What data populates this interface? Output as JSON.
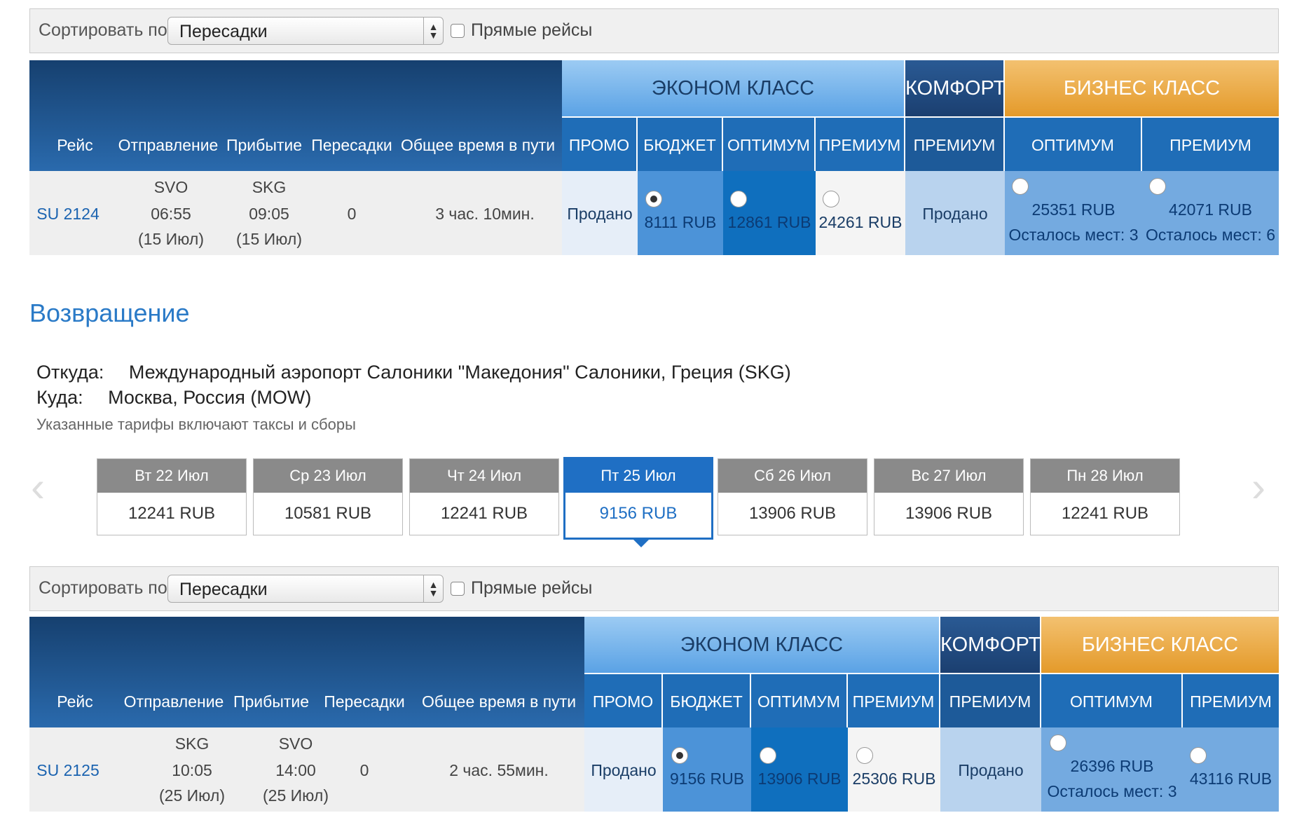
{
  "sort": {
    "label": "Сортировать по",
    "value": "Пересадки",
    "direct_label": "Прямые рейсы"
  },
  "columns": {
    "flight": "Рейс",
    "departure": "Отправление",
    "arrival": "Прибытие",
    "stops": "Пересадки",
    "duration": "Общее время в пути"
  },
  "classes": {
    "economy": "ЭКОНОМ КЛАСС",
    "comfort": "КОМФОРТ",
    "business": "БИЗНЕС КЛАСС"
  },
  "tariffs": {
    "promo": "ПРОМО",
    "budget": "БЮДЖЕТ",
    "optimum": "ОПТИМУМ",
    "premium": "ПРЕМИУМ"
  },
  "outbound": {
    "flight": "SU 2124",
    "from": "SVO",
    "dep_time": "06:55",
    "dep_date": "(15 Июл)",
    "to": "SKG",
    "arr_time": "09:05",
    "arr_date": "(15 Июл)",
    "stops": "0",
    "duration": "3 час. 10мин.",
    "promo": "Продано",
    "budget": "8111 RUB",
    "optimum": "12861 RUB",
    "premium": "24261 RUB",
    "comfort": "Продано",
    "biz_optimum": "25351 RUB",
    "biz_optimum_seats": "Осталось мест: 3",
    "biz_premium": "42071 RUB",
    "biz_premium_seats": "Осталось мест: 6"
  },
  "return": {
    "title": "Возвращение",
    "from_label": "Откуда:",
    "from": "Международный аэропорт Салоники \"Македония\" Салоники, Греция (SKG)",
    "to_label": "Куда:",
    "to": "Москва, Россия (MOW)",
    "note": "Указанные тарифы включают таксы и сборы",
    "days": [
      {
        "label": "Вт 22 Июл",
        "price": "12241 RUB"
      },
      {
        "label": "Ср 23 Июл",
        "price": "10581 RUB"
      },
      {
        "label": "Чт 24 Июл",
        "price": "12241 RUB"
      },
      {
        "label": "Пт 25 Июл",
        "price": "9156 RUB"
      },
      {
        "label": "Сб 26 Июл",
        "price": "13906 RUB"
      },
      {
        "label": "Вс 27 Июл",
        "price": "13906 RUB"
      },
      {
        "label": "Пн 28 Июл",
        "price": "12241 RUB"
      }
    ],
    "flight": "SU 2125",
    "from_code": "SKG",
    "dep_time": "10:05",
    "dep_date": "(25 Июл)",
    "to_code": "SVO",
    "arr_time": "14:00",
    "arr_date": "(25 Июл)",
    "stops": "0",
    "duration": "2 час. 55мин.",
    "promo": "Продано",
    "budget": "9156 RUB",
    "optimum": "13906 RUB",
    "premium": "25306 RUB",
    "comfort": "Продано",
    "biz_optimum": "26396 RUB",
    "biz_optimum_seats": "Осталось мест: 3",
    "biz_premium": "43116 RUB"
  }
}
